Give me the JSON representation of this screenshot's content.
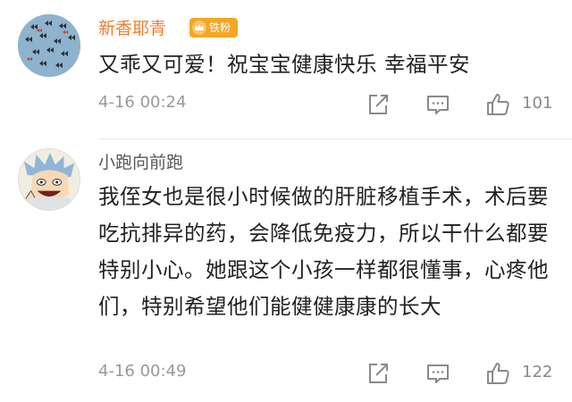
{
  "comments": [
    {
      "username": "新香耶青",
      "badge": "铁粉",
      "avatar_icon": "butterfly-avatar",
      "text": "又乖又可爱！祝宝宝健康快乐 幸福平安",
      "time": "4-16 00:24",
      "likes": "101"
    },
    {
      "username": "小跑向前跑",
      "avatar_icon": "anime-character-avatar",
      "text": "我侄女也是很小时候做的肝脏移植手术，术后要吃抗排异的药，会降低免疫力，所以干什么都要特别小心。她跟这个小孩一样都很懂事，心疼他们，特别希望他们能健健康康的长大",
      "time": "4-16 00:49",
      "likes": "122"
    }
  ],
  "colors": {
    "username_highlight": "#ef7d2d",
    "badge_bg": "#f5a623",
    "meta_gray": "#999999"
  }
}
